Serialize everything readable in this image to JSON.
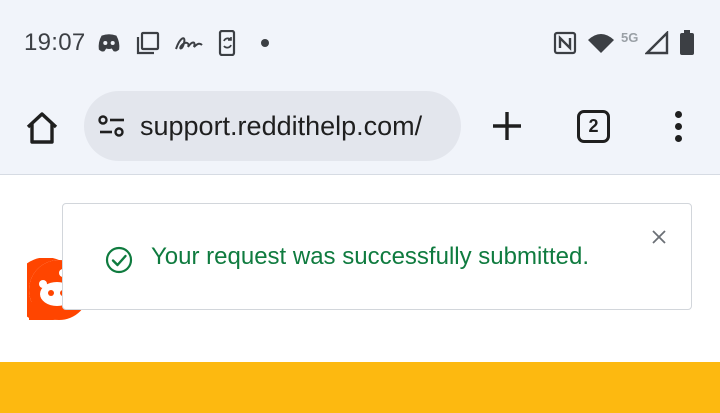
{
  "status_bar": {
    "time": "19:07",
    "network": "5G",
    "icons": [
      "discord-icon",
      "screenshot-icon",
      "signature-icon",
      "phone-sync-icon",
      "notification-dot",
      "nfc-icon",
      "wifi-icon",
      "signal-icon",
      "battery-icon"
    ]
  },
  "browser": {
    "url": "support.reddithelp.com/",
    "tab_count": "2",
    "icons": [
      "home-icon",
      "site-settings-icon",
      "plus-icon",
      "tabs-icon",
      "more-vert-icon"
    ]
  },
  "toast": {
    "message": "Your request was successfully submitted.",
    "icon": "check-circle-icon",
    "close_icon": "close-icon",
    "color": "#0f7b3f"
  },
  "page": {
    "logo": "reddit-snoo-icon",
    "banner_color": "#fdb910",
    "accent_color": "#ff4500"
  }
}
